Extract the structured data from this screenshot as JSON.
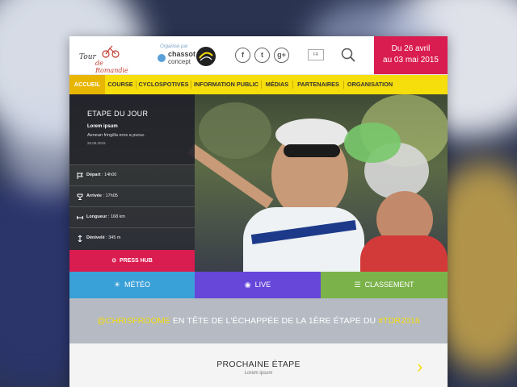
{
  "header": {
    "logo_line1": "Tour",
    "logo_line2": "de Romandie",
    "org_label": "Organisé par",
    "org_name": "chassot",
    "org_name2": "concept",
    "social": [
      "f",
      "t",
      "g+"
    ],
    "lang_label": "FR",
    "dates_line1": "Du 26 avril",
    "dates_line2": "au 03 mai 2015"
  },
  "nav": {
    "items": [
      "ACCUEIL",
      "COURSE",
      "CYCLOSPOTIVES",
      "INFORMATION PUBLIC",
      "MÉDIAS",
      "PARTENAIRES",
      "ORGANISATION"
    ]
  },
  "stage": {
    "title": "ETAPE DU JOUR",
    "subtitle": "Lorem ipsum",
    "text": "Aenean fringilla eros a purus.",
    "date": "26.05.2015",
    "rows": [
      {
        "label": "Départ",
        "value": "14h00",
        "icon": "flag-icon"
      },
      {
        "label": "Arrivée",
        "value": "17h05",
        "icon": "trophy-icon"
      },
      {
        "label": "Longueur",
        "value": "168 km",
        "icon": "distance-icon"
      },
      {
        "label": "Dénivelé",
        "value": "345 m",
        "icon": "elevation-icon"
      }
    ],
    "press_label": "PRESS HUB"
  },
  "actions": {
    "meteo": "MÉTÉO",
    "live": "LIVE",
    "classement": "CLASSEMENT"
  },
  "tweet": {
    "handle": "@CHRISFROOME",
    "text": "EN TÊTE DE L'ÉCHAPPÉE DE LA 1ÈRE ÉTAPE DU",
    "hashtag": "#TDR2016"
  },
  "next_stage": {
    "title": "PROCHAINE ÉTAPE",
    "subtitle": "Lorem ipsum"
  },
  "colors": {
    "accent_red": "#d91d50",
    "nav_yellow": "#f6dd0c",
    "meteo_blue": "#3aa0d8",
    "live_purple": "#6647d9",
    "classement_green": "#7bb34a"
  }
}
